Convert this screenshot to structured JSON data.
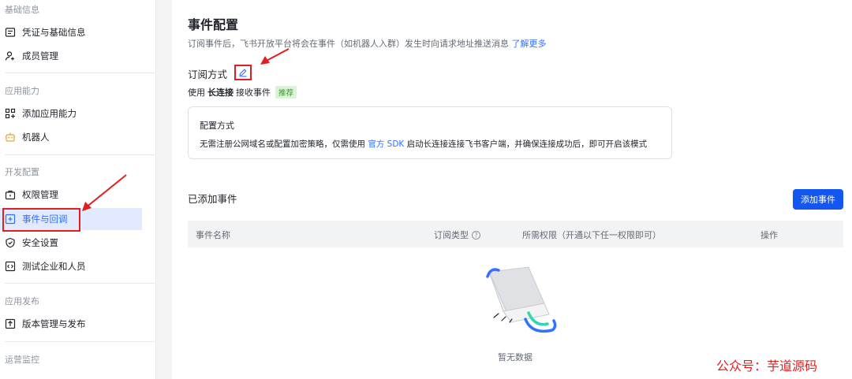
{
  "sidebar": {
    "sections": {
      "basic": "基础信息",
      "ability": "应用能力",
      "dev": "开发配置",
      "publish": "应用发布",
      "ops": "运营监控"
    },
    "items": {
      "credentials": "凭证与基础信息",
      "members": "成员管理",
      "add_ability": "添加应用能力",
      "bot": "机器人",
      "permissions": "权限管理",
      "events": "事件与回调",
      "security": "安全设置",
      "test_org": "测试企业和人员",
      "versions": "版本管理与发布"
    }
  },
  "main": {
    "title": "事件配置",
    "desc": "订阅事件后，飞书开放平台将会在事件（如机器人入群）发生时向请求地址推送消息",
    "desc_link": "了解更多",
    "subscription_title": "订阅方式",
    "use_prefix": "使用",
    "use_mode": "长连接",
    "use_suffix": "接收事件",
    "badge": "推荐",
    "config": {
      "title": "配置方式",
      "desc_pre": "无需注册公网域名或配置加密策略，仅需使用",
      "desc_link": "官方 SDK",
      "desc_post": "启动长连接连接飞书客户端，并确保连接成功后，即可开启该模式"
    },
    "events_title": "已添加事件",
    "add_button": "添加事件",
    "table": {
      "col_name": "事件名称",
      "col_type": "订阅类型",
      "col_perm": "所需权限（开通以下任一权限即可）",
      "col_ops": "操作"
    },
    "empty": "暂无数据"
  },
  "watermark": "公众号：芋道源码",
  "colors": {
    "accent": "#3370ff",
    "annotation": "#e02020",
    "active_bg": "#e1eaff"
  }
}
